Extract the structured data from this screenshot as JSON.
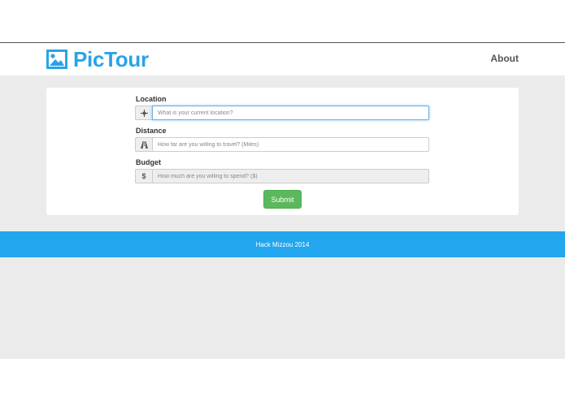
{
  "header": {
    "brand": "PicTour",
    "nav": {
      "about": "About"
    }
  },
  "form": {
    "location": {
      "label": "Location",
      "placeholder": "What is your current location?",
      "icon": "crosshair-icon"
    },
    "distance": {
      "label": "Distance",
      "placeholder": "How far are you willing to travel? (Miles)",
      "icon": "road-icon"
    },
    "budget": {
      "label": "Budget",
      "placeholder": "How much are you willing to spend? ($)",
      "addon": "$",
      "icon": "dollar-icon"
    },
    "submit_label": "Submit"
  },
  "footer": {
    "text": "Hack Mizzou 2014"
  },
  "colors": {
    "brand": "#29a3e8",
    "footer": "#22a6ee",
    "submit": "#5cb85c",
    "page_bg": "#ebebeb"
  }
}
